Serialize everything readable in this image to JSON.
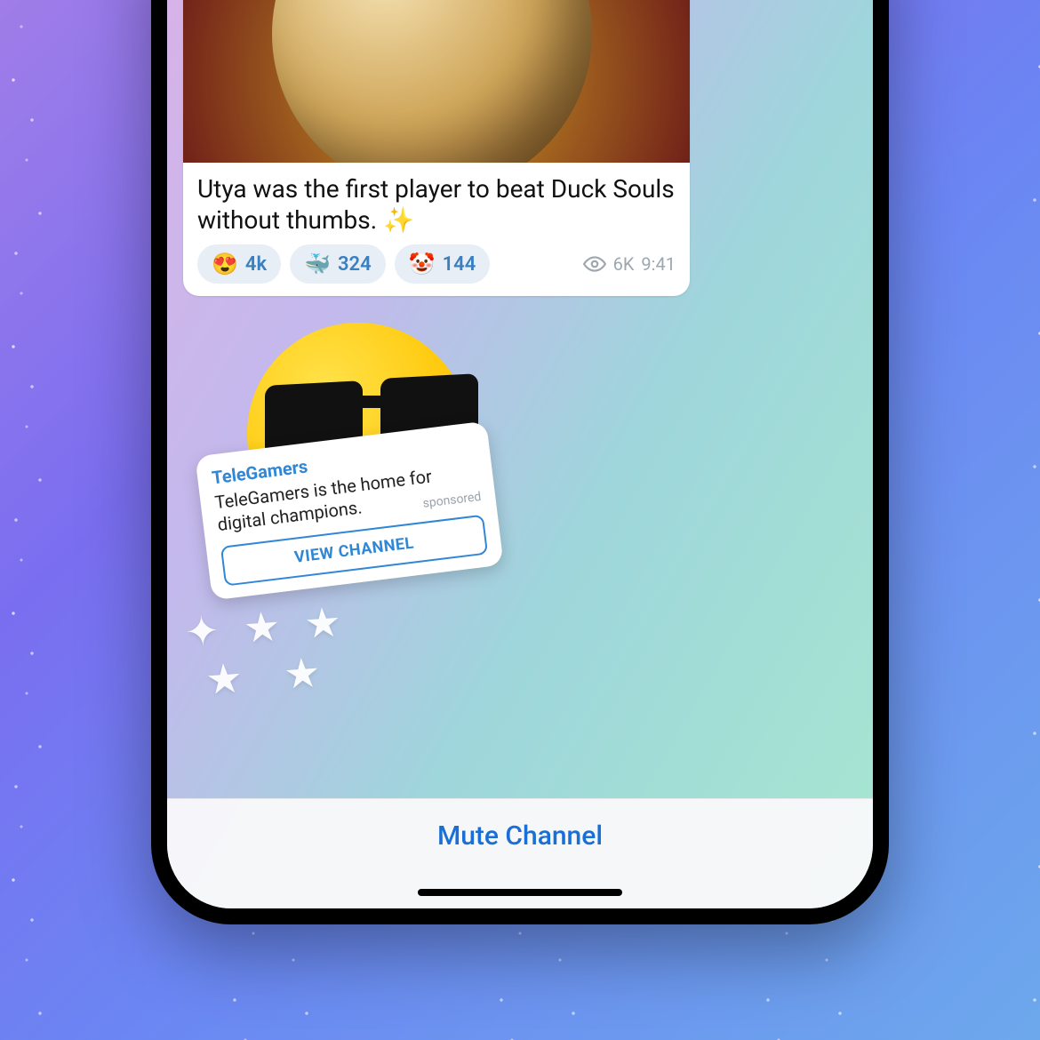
{
  "post": {
    "text": "Utya was the first player to beat Duck Souls without thumbs. ✨",
    "reactions": [
      {
        "emoji": "😍",
        "count": "4k"
      },
      {
        "emoji": "🐳",
        "count": "324"
      },
      {
        "emoji": "🤡",
        "count": "144"
      }
    ],
    "views": "6K",
    "time": "9:41"
  },
  "promo": {
    "title": "TeleGamers",
    "body": "TeleGamers is the home for digital champions.",
    "sponsored_label": "sponsored",
    "button": "VIEW CHANNEL"
  },
  "bottom": {
    "mute_label": "Mute Channel"
  },
  "colors": {
    "accent": "#1a6fd6"
  }
}
